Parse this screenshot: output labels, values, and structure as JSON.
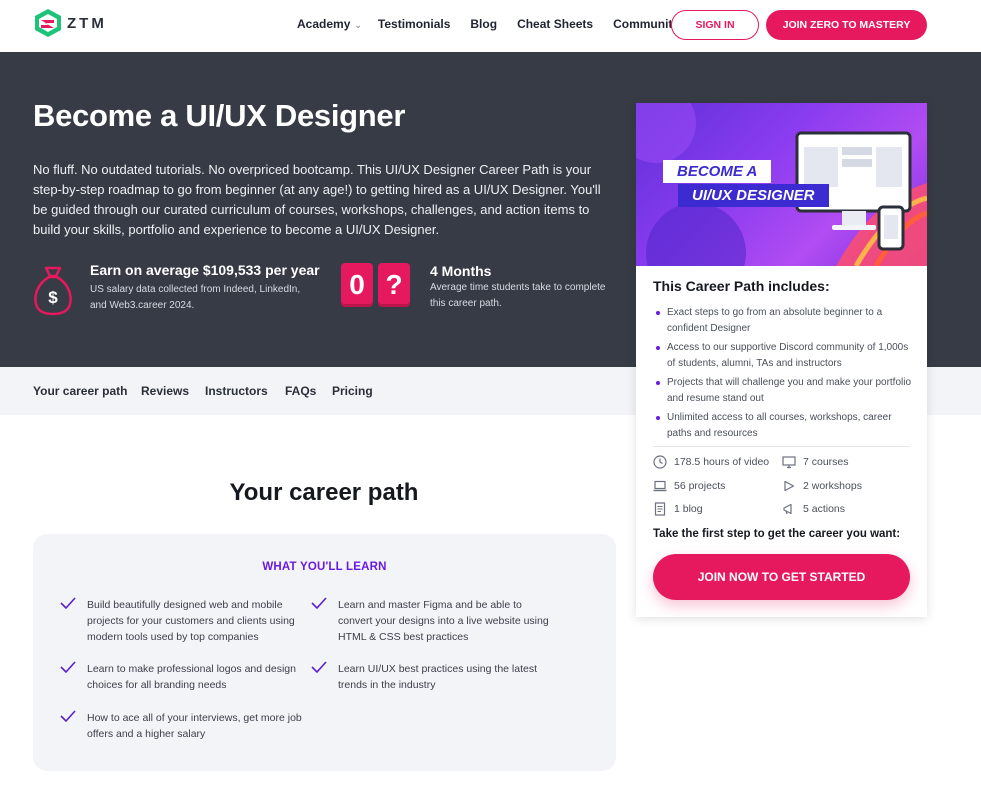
{
  "nav": {
    "logo_text": "ZTM",
    "links": [
      {
        "label": "Academy",
        "has_dropdown": true
      },
      {
        "label": "Testimonials"
      },
      {
        "label": "Blog"
      },
      {
        "label": "Cheat Sheets"
      },
      {
        "label": "Community"
      }
    ],
    "signin_label": "SIGN IN",
    "join_label": "JOIN ZERO TO MASTERY"
  },
  "hero": {
    "title": "Become a UI/UX Designer",
    "description": "No fluff. No outdated tutorials. No overpriced bootcamp. This UI/UX Designer Career Path is your step-by-step roadmap to go from beginner (at any age!) to getting hired as a UI/UX Designer. You'll be guided through our curated curriculum of courses, workshops, challenges, and action items to build your skills, portfolio and experience to become a UI/UX Designer.",
    "salary": {
      "title": "Earn on average $109,533 per year",
      "subtitle": "US salary data collected from Indeed, LinkedIn, and Web3.career 2024.",
      "icon": "money-bag-icon"
    },
    "duration": {
      "digits": [
        "0",
        "?"
      ],
      "title": "4 Months",
      "subtitle": "Average time students take to complete this career path."
    }
  },
  "subnav": {
    "items": [
      "Your career path",
      "Reviews",
      "Instructors",
      "FAQs",
      "Pricing"
    ]
  },
  "career_path": {
    "title": "Your career path",
    "learn_heading": "WHAT YOU'LL LEARN",
    "items": [
      "Build beautifully designed web and mobile projects for your customers and clients using modern tools used by top companies",
      "Learn and master Figma and be able to convert your designs into a live website using HTML & CSS best practices",
      "Learn to make professional logos and design choices for all branding needs",
      "Learn UI/UX best practices using the latest trends in the industry",
      "How to ace all of your interviews, get more job offers and a higher salary"
    ]
  },
  "card": {
    "banner_line1": "BECOME A",
    "banner_line2": "UI/UX DESIGNER",
    "heading": "This Career Path includes:",
    "bullets": [
      "Exact steps to go from an absolute beginner to a confident Designer",
      "Access to our supportive Discord community of 1,000s of students, alumni, TAs and instructors",
      "Projects that will challenge you and make your portfolio and resume stand out",
      "Unlimited access to all courses, workshops, career paths and resources"
    ],
    "features": [
      {
        "label": "178.5 hours of video",
        "icon": "clock-icon"
      },
      {
        "label": "7 courses",
        "icon": "monitor-icon"
      },
      {
        "label": "56 projects",
        "icon": "laptop-icon"
      },
      {
        "label": "2 workshops",
        "icon": "play-icon"
      },
      {
        "label": "1 blog",
        "icon": "document-icon"
      },
      {
        "label": "5 actions",
        "icon": "megaphone-icon"
      }
    ],
    "cta_text": "Take the first step to get the career you want:",
    "cta_button": "JOIN NOW TO GET STARTED"
  },
  "colors": {
    "accent": "#e6195e",
    "purple": "#6a1be0",
    "hero_bg": "#373b45"
  }
}
